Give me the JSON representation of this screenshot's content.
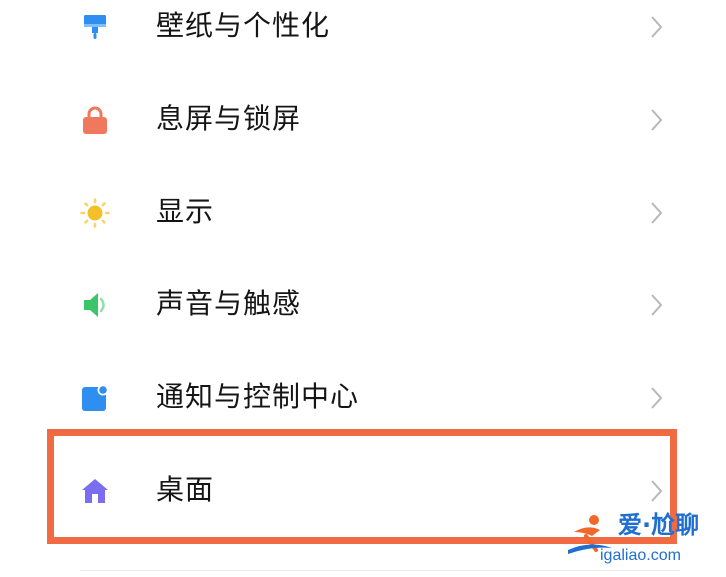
{
  "settings": {
    "items": [
      {
        "label": "壁纸与个性化",
        "icon": "paintbrush-icon",
        "color": "#2e8ff0"
      },
      {
        "label": "息屏与锁屏",
        "icon": "lock-icon",
        "color": "#f0785c"
      },
      {
        "label": "显示",
        "icon": "sun-icon",
        "color": "#f5bf2a"
      },
      {
        "label": "声音与触感",
        "icon": "speaker-icon",
        "color": "#3cc46a"
      },
      {
        "label": "通知与控制中心",
        "icon": "notification-icon",
        "color": "#2e8ff0"
      },
      {
        "label": "桌面",
        "icon": "home-icon",
        "color": "#7a6df0"
      }
    ],
    "highlighted_item": "桌面",
    "highlight_color": "#f06a43"
  },
  "watermark": {
    "title": "爱·尬聊",
    "url": "igaliao.com",
    "color": "#1e6fd0"
  }
}
